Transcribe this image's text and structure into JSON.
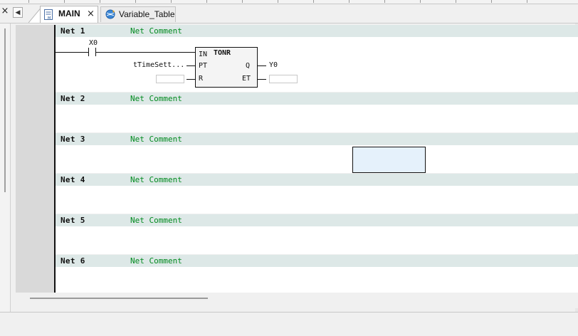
{
  "tabs": {
    "close_all_label": "×",
    "scroll_left_label": "◀",
    "items": [
      {
        "label": "MAIN",
        "active": true,
        "close_label": "×",
        "icon": "ladder-diagram-icon"
      },
      {
        "label": "Variable_Table",
        "active": false,
        "icon": "variable-table-globe-icon"
      }
    ]
  },
  "networks": [
    {
      "label": "Net 1",
      "comment": "Net Comment"
    },
    {
      "label": "Net 2",
      "comment": "Net Comment"
    },
    {
      "label": "Net 3",
      "comment": "Net Comment"
    },
    {
      "label": "Net 4",
      "comment": "Net Comment"
    },
    {
      "label": "Net 5",
      "comment": "Net Comment"
    },
    {
      "label": "Net 6",
      "comment": "Net Comment"
    }
  ],
  "net1": {
    "contact_variable": "X0",
    "timer_block": {
      "name": "TONR",
      "input_pins": [
        "IN",
        "PT",
        "R"
      ],
      "output_pins": [
        "Q",
        "ET"
      ],
      "pt_variable": "tTimeSett...",
      "q_variable": "Y0"
    }
  },
  "colors": {
    "rung_header": "#dde8e7",
    "comment_text": "#008a1e",
    "selection_fill": "#e5f1fb"
  }
}
